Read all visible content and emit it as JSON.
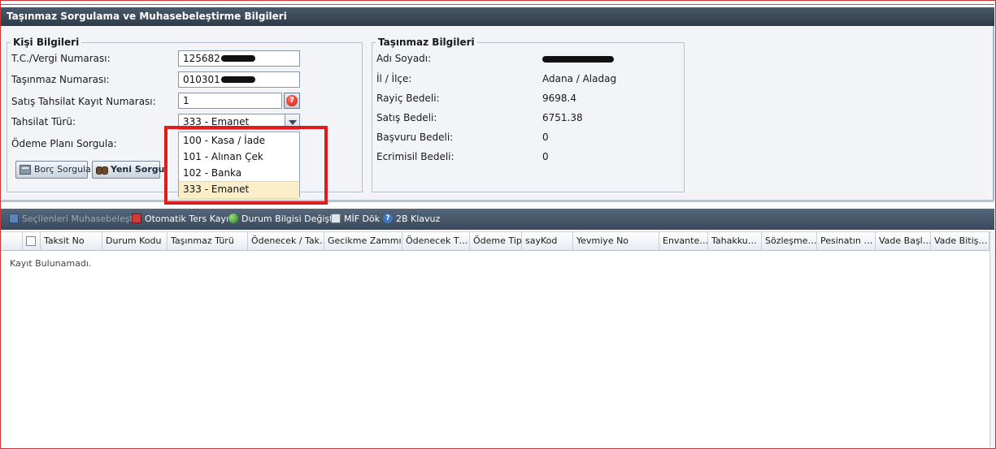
{
  "window": {
    "title": "Taşınmaz Sorgulama ve Muhasebeleştirme Bilgileri"
  },
  "kisi": {
    "legend": "Kişi Bilgileri",
    "tc_label": "T.C./Vergi Numarası:",
    "tc_value": "125682",
    "tasinmaz_label": "Taşınmaz Numarası:",
    "tasinmaz_value": "010301",
    "satis_label": "Satış Tahsilat Kayıt Numarası:",
    "satis_value": "1",
    "tahsilat_label": "Tahsilat Türü:",
    "tahsilat_value": "333 - Emanet",
    "odeme_label": "Ödeme Planı Sorgula:",
    "borc_button": "Borç Sorgula",
    "yeni_button": "Yeni Sorgu"
  },
  "dropdown": {
    "options": [
      "100 - Kasa / İade",
      "101 - Alınan Çek",
      "102 - Banka",
      "333 - Emanet"
    ],
    "selected": "333 - Emanet"
  },
  "tasinmaz": {
    "legend": "Taşınmaz Bilgileri",
    "rows": [
      {
        "label": "Adı Soyadı:",
        "value": ""
      },
      {
        "label": "İl / İlçe:",
        "value": "Adana / Aladag"
      },
      {
        "label": "Rayiç Bedeli:",
        "value": "9698.4"
      },
      {
        "label": "Satış Bedeli:",
        "value": "6751.38"
      },
      {
        "label": "Başvuru Bedeli:",
        "value": "0"
      },
      {
        "label": "Ecrimisil Bedeli:",
        "value": "0"
      }
    ]
  },
  "toolbar": {
    "muhasebe": "Seçilenleri Muhasebeleştir",
    "ters_kayit": "Otomatik Ters Kayıt",
    "durum": "Durum Bilgisi Değiştir",
    "mif": "MİF Dök",
    "klavuz": "2B Klavuz"
  },
  "grid": {
    "columns": [
      "Taksit No",
      "Durum Kodu",
      "Taşınmaz Türü",
      "Ödenecek / Tak…",
      "Gecikme Zammı",
      "Ödenecek T…",
      "Ödeme Tipi",
      "sayKod",
      "Yevmiye No",
      "Envante…",
      "Tahakku…",
      "Sözleşme…",
      "Pesinatın …",
      "Vade Başl…",
      "Vade Bitiş…"
    ],
    "empty_text": "Kayıt Bulunamadı."
  },
  "colors": {
    "highlight": "#e01b1b",
    "header": "#2e3a47",
    "selected_option": "#fbeec8"
  }
}
